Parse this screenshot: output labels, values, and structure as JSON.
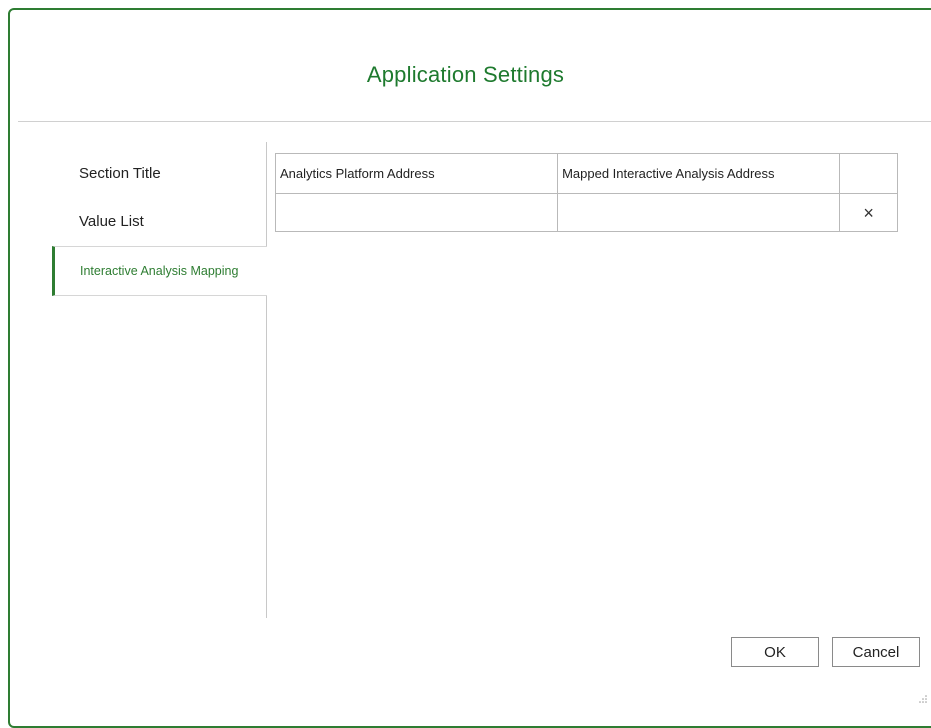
{
  "dialog": {
    "title": "Application Settings"
  },
  "sidebar": {
    "items": [
      {
        "label": "Section Title"
      },
      {
        "label": "Value List"
      },
      {
        "label": "Interactive Analysis Mapping"
      }
    ]
  },
  "mapping_table": {
    "headers": [
      "Analytics Platform Address",
      "Mapped Interactive Analysis Address",
      ""
    ],
    "rows": [
      {
        "platform_address": "",
        "mapped_address": "",
        "delete_icon": "×"
      }
    ]
  },
  "buttons": {
    "ok_label": "OK",
    "cancel_label": "Cancel"
  },
  "colors": {
    "accent": "#2e7d32",
    "border": "#b9b9b9"
  },
  "icons": {
    "row_delete": "close-icon",
    "resize": "resize-grip-icon"
  }
}
